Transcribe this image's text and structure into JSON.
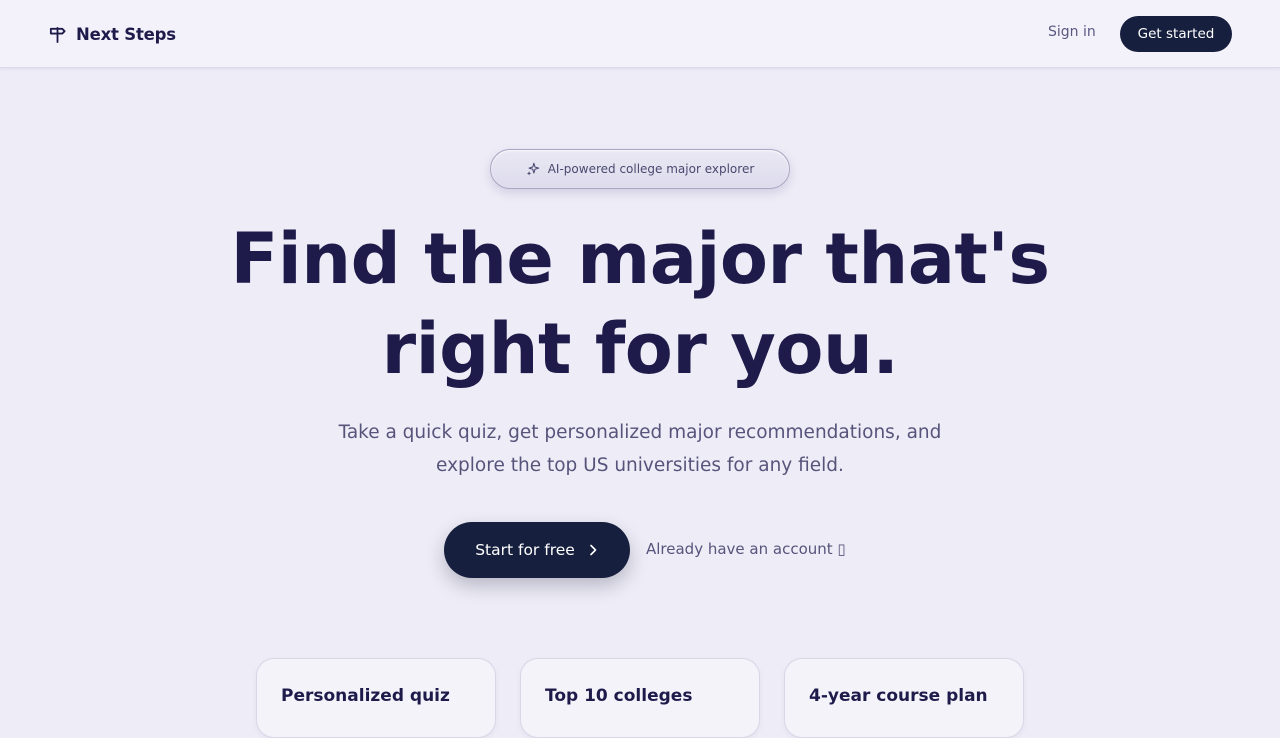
{
  "nav": {
    "brand_name": "Next Steps",
    "brand_icon": "signpost-icon",
    "signin_label": "Sign in",
    "get_started_label": "Get started"
  },
  "hero": {
    "badge_icon": "sparkles-icon",
    "badge_text": "AI-powered college major explorer",
    "title_lines": [
      "Find the major that's",
      "right for you."
    ],
    "subtitle_lines": [
      "Take a quick quiz, get personalized major recommendations, and",
      "explore the top US universities for any field."
    ],
    "cta_label": "Start for free",
    "cta_icon": "chevron-right-icon",
    "secondary_link": "Already have an account ▯"
  },
  "features": [
    {
      "title": "Personalized quiz"
    },
    {
      "title": "Top 10 colleges"
    },
    {
      "title": "4-year course plan"
    }
  ],
  "colors": {
    "background": "#eeecf6",
    "primary_dark": "#161f3d",
    "heading": "#1e1b4b",
    "muted_text": "#57547c"
  }
}
